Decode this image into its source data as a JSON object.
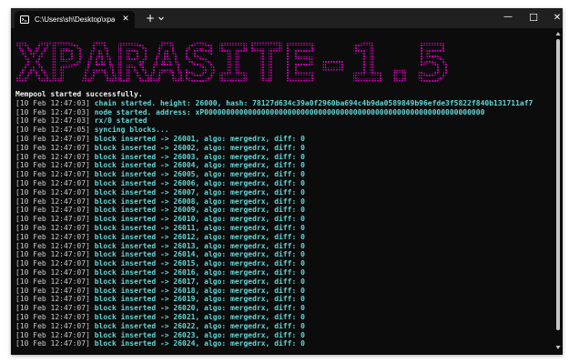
{
  "tab": {
    "title": "C:\\Users\\sh\\Desktop\\xparasite.exe",
    "icon": "terminal-icon",
    "close_label": "✕"
  },
  "titlebar": {
    "new_tab_label": "+",
    "dropdown_icon": "chevron-down-icon",
    "minimize_label": "—",
    "maximize_label": "☐",
    "close_label": "✕"
  },
  "banner": {
    "text": "XPARASITE-1.5",
    "color": "#b4009e"
  },
  "colors": {
    "window_bg": "#0c0c0c",
    "titlebar_bg": "#202020",
    "timestamp": "#cccccc",
    "message": "#61d6d6",
    "plain_text": "#f2f2f2",
    "scrollbar_thumb": "#c8c8c8"
  },
  "scroll": {
    "thumb_fraction": 0.96,
    "position": 0.0
  },
  "log": [
    {
      "ts": "",
      "msg": "Mempool started successfully.",
      "plain": true
    },
    {
      "ts": "[10 Feb 12:47:03]",
      "msg": "chain started. height: 26000, hash: 78127d634c39a0f2960ba694c4b9da0589849b96efde3f5822f840b131711af7"
    },
    {
      "ts": "[10 Feb 12:47:03]",
      "msg": "node started. address: xP0000000000000000000000000000000000000000000000000000000000000000"
    },
    {
      "ts": "[10 Feb 12:47:03]",
      "msg": "rx/0 started"
    },
    {
      "ts": "[10 Feb 12:47:05]",
      "msg": "syncing blocks..."
    },
    {
      "ts": "[10 Feb 12:47:07]",
      "msg": "block inserted -> 26001, algo: mergedrx, diff: 0"
    },
    {
      "ts": "[10 Feb 12:47:07]",
      "msg": "block inserted -> 26002, algo: mergedrx, diff: 0"
    },
    {
      "ts": "[10 Feb 12:47:07]",
      "msg": "block inserted -> 26003, algo: mergedrx, diff: 0"
    },
    {
      "ts": "[10 Feb 12:47:07]",
      "msg": "block inserted -> 26004, algo: mergedrx, diff: 0"
    },
    {
      "ts": "[10 Feb 12:47:07]",
      "msg": "block inserted -> 26005, algo: mergedrx, diff: 0"
    },
    {
      "ts": "[10 Feb 12:47:07]",
      "msg": "block inserted -> 26006, algo: mergedrx, diff: 0"
    },
    {
      "ts": "[10 Feb 12:47:07]",
      "msg": "block inserted -> 26007, algo: mergedrx, diff: 0"
    },
    {
      "ts": "[10 Feb 12:47:07]",
      "msg": "block inserted -> 26008, algo: mergedrx, diff: 0"
    },
    {
      "ts": "[10 Feb 12:47:07]",
      "msg": "block inserted -> 26009, algo: mergedrx, diff: 0"
    },
    {
      "ts": "[10 Feb 12:47:07]",
      "msg": "block inserted -> 26010, algo: mergedrx, diff: 0"
    },
    {
      "ts": "[10 Feb 12:47:07]",
      "msg": "block inserted -> 26011, algo: mergedrx, diff: 0"
    },
    {
      "ts": "[10 Feb 12:47:07]",
      "msg": "block inserted -> 26012, algo: mergedrx, diff: 0"
    },
    {
      "ts": "[10 Feb 12:47:07]",
      "msg": "block inserted -> 26013, algo: mergedrx, diff: 0"
    },
    {
      "ts": "[10 Feb 12:47:07]",
      "msg": "block inserted -> 26014, algo: mergedrx, diff: 0"
    },
    {
      "ts": "[10 Feb 12:47:07]",
      "msg": "block inserted -> 26015, algo: mergedrx, diff: 0"
    },
    {
      "ts": "[10 Feb 12:47:07]",
      "msg": "block inserted -> 26016, algo: mergedrx, diff: 0"
    },
    {
      "ts": "[10 Feb 12:47:07]",
      "msg": "block inserted -> 26017, algo: mergedrx, diff: 0"
    },
    {
      "ts": "[10 Feb 12:47:07]",
      "msg": "block inserted -> 26018, algo: mergedrx, diff: 0"
    },
    {
      "ts": "[10 Feb 12:47:07]",
      "msg": "block inserted -> 26019, algo: mergedrx, diff: 0"
    },
    {
      "ts": "[10 Feb 12:47:07]",
      "msg": "block inserted -> 26020, algo: mergedrx, diff: 0"
    },
    {
      "ts": "[10 Feb 12:47:07]",
      "msg": "block inserted -> 26021, algo: mergedrx, diff: 0"
    },
    {
      "ts": "[10 Feb 12:47:07]",
      "msg": "block inserted -> 26022, algo: mergedrx, diff: 0"
    },
    {
      "ts": "[10 Feb 12:47:07]",
      "msg": "block inserted -> 26023, algo: mergedrx, diff: 0"
    },
    {
      "ts": "[10 Feb 12:47:07]",
      "msg": "block inserted -> 26024, algo: mergedrx, diff: 0"
    }
  ]
}
